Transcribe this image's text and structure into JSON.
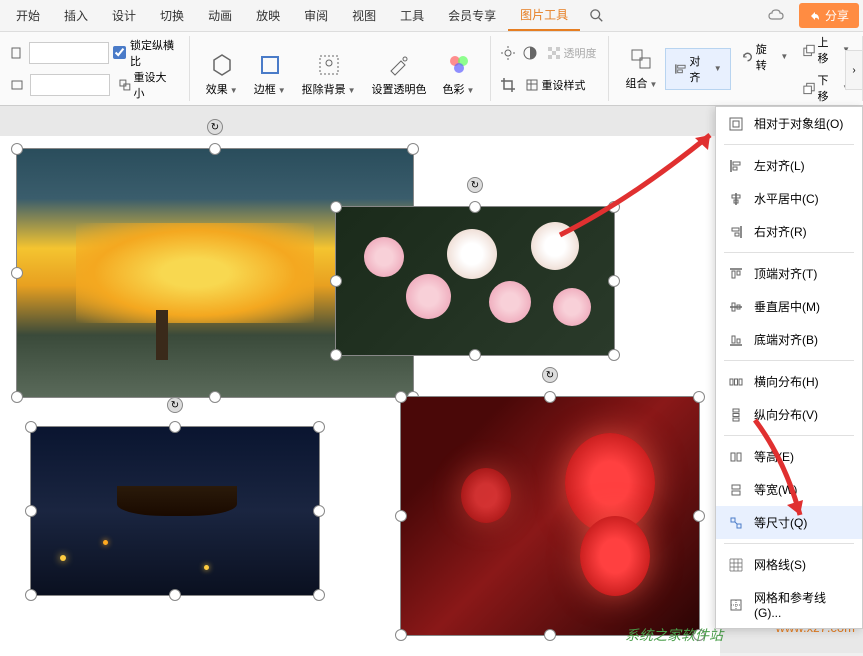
{
  "menu": {
    "items": [
      "开始",
      "插入",
      "设计",
      "切换",
      "动画",
      "放映",
      "审阅",
      "视图",
      "工具",
      "会员专享",
      "图片工具"
    ],
    "active_index": 10,
    "share": "分享"
  },
  "toolbar": {
    "lock_ratio": "锁定纵横比",
    "reset_size": "重设大小",
    "effects": "效果",
    "border": "边框",
    "remove_bg": "抠除背景",
    "set_transparent": "设置透明色",
    "color": "色彩",
    "transparency": "透明度",
    "reset_style": "重设样式",
    "group": "组合",
    "align": "对齐",
    "rotate": "旋转",
    "move_up": "上移",
    "move_down": "下移"
  },
  "align_menu": {
    "relative": "相对于对象组(O)",
    "left": "左对齐(L)",
    "center_h": "水平居中(C)",
    "right": "右对齐(R)",
    "top": "顶端对齐(T)",
    "middle_v": "垂直居中(M)",
    "bottom": "底端对齐(B)",
    "dist_h": "横向分布(H)",
    "dist_v": "纵向分布(V)",
    "equal_h": "等高(E)",
    "equal_w": "等宽(W)",
    "equal_size": "等尺寸(Q)",
    "gridlines": "网格线(S)",
    "grid_guides": "网格和参考线(G)..."
  },
  "watermark": {
    "text": "系统之家软件站",
    "url": "www.xz7.com"
  }
}
